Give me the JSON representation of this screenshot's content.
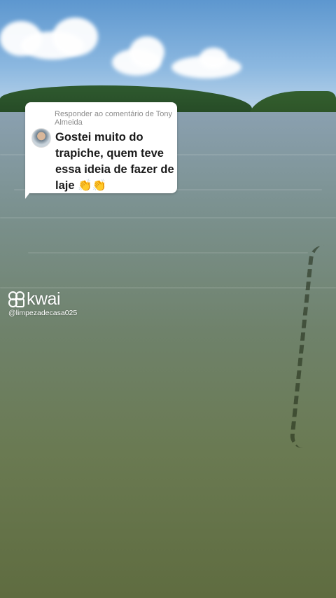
{
  "comment": {
    "reply_label": "Responder ao comentário de Tony Almeida",
    "text": "Gostei muito do trapiche, quem teve essa ideia de fazer de laje 👏👏",
    "avatar_icon": "user-avatar"
  },
  "watermark": {
    "brand": "kwai",
    "handle": "@limpezadecasa025",
    "logo_icon": "kwai-logo-icon"
  },
  "colors": {
    "bubble": "#ffffff",
    "comment_text": "#1a1a1a",
    "reply_label": "#8c8c8c",
    "watermark": "#ffffff"
  }
}
